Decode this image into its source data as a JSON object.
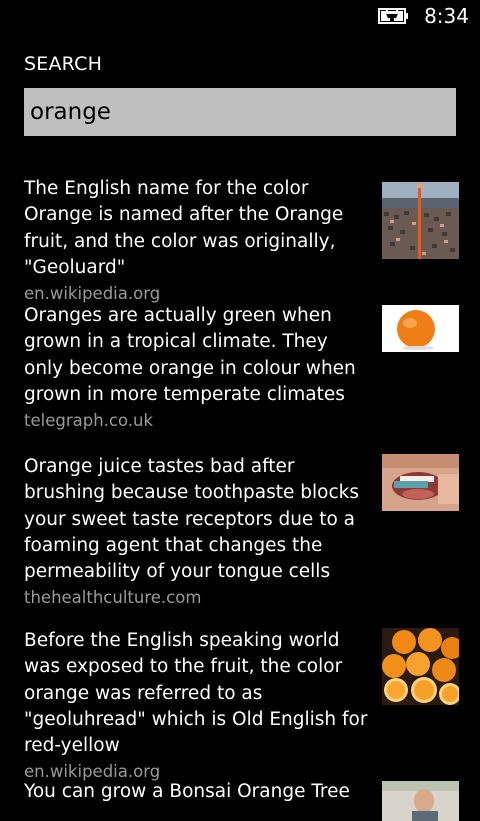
{
  "status_bar": {
    "time": "8:34",
    "battery_icon": "battery-charging-icon"
  },
  "search": {
    "title": "SEARCH",
    "query": "orange"
  },
  "results": [
    {
      "text": "The English name for the color Orange is named after the Orange fruit, and the color was originally, \"Geoluard\"",
      "source": "en.wikipedia.org",
      "thumbnail": "stadium-crowd-image"
    },
    {
      "text": "Oranges are actually green when grown in a tropical climate. They only become orange in colour when grown in more temperate climates",
      "source": "telegraph.co.uk",
      "thumbnail": "orange-fruit-image"
    },
    {
      "text": "Orange juice tastes bad after brushing because toothpaste blocks your sweet taste receptors due to a foaming agent that changes the permeability of your tongue cells",
      "source": "thehealthculture.com",
      "thumbnail": "brushing-teeth-image"
    },
    {
      "text": "Before the English speaking world was exposed to the fruit, the color orange was referred to as \"geoluhread\" which is Old English for red-yellow",
      "source": "en.wikipedia.org",
      "thumbnail": "orange-slices-image"
    },
    {
      "text": "You can grow a Bonsai Orange Tree",
      "source": "",
      "thumbnail": "person-photo-image"
    }
  ]
}
